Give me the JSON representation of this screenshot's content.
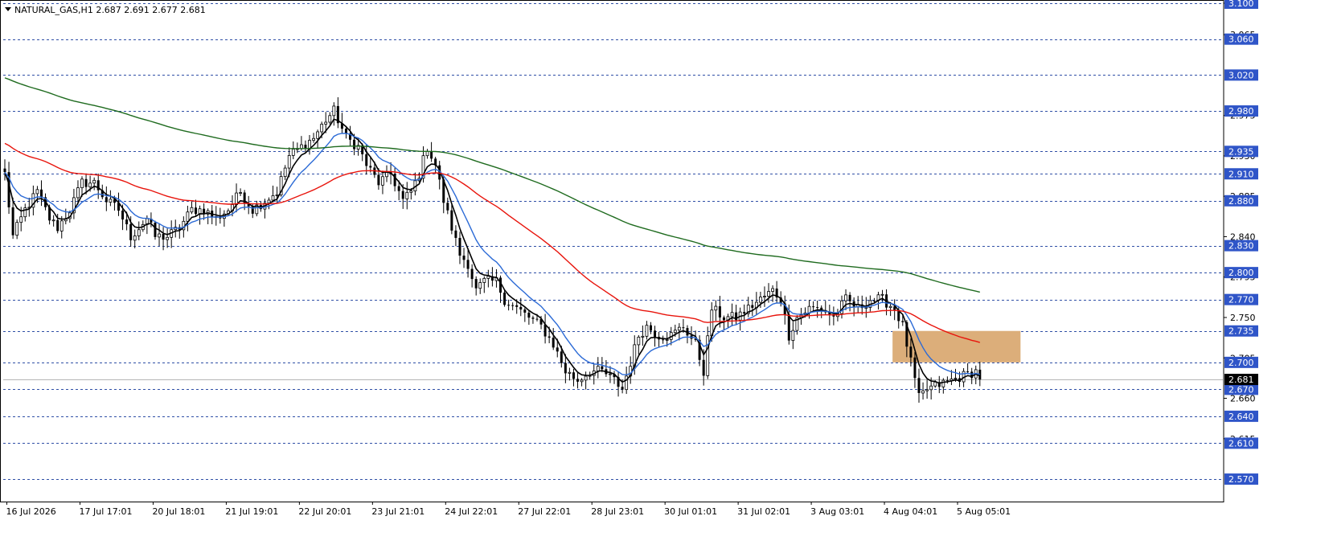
{
  "header": {
    "symbol_line": "NATURAL_GAS,H1  2.687 2.691 2.677 2.681",
    "menu_icon": "triangle-down-icon"
  },
  "colors": {
    "background": "#ffffff",
    "grid_dashed": "#2f4fa6",
    "price_label_bg": "#2f55c8",
    "current_price_bg": "#000000",
    "ma_fast": "#000000",
    "ma_mid": "#2b6ad6",
    "ma_slow": "#e8140c",
    "ma_long": "#1f6b1f",
    "zone": "#dcae7a",
    "candle": "#000000"
  },
  "chart_data": {
    "type": "candlestick",
    "symbol": "NATURAL_GAS",
    "timeframe": "H1",
    "ohlc_last": {
      "open": 2.687,
      "high": 2.691,
      "low": 2.677,
      "close": 2.681
    },
    "ylim": [
      2.545,
      3.1
    ],
    "x_tick_labels": [
      "16 Jul 2026",
      "17 Jul 17:01",
      "20 Jul 18:01",
      "21 Jul 19:01",
      "22 Jul 20:01",
      "23 Jul 21:01",
      "24 Jul 22:01",
      "27 Jul 22:01",
      "28 Jul 23:01",
      "30 Jul 01:01",
      "31 Jul 02:01",
      "3 Aug 03:01",
      "4 Aug 04:01",
      "5 Aug 05:01"
    ],
    "x_tick_positions": [
      0.5,
      18.5,
      36.5,
      54.5,
      72.5,
      90.5,
      108.5,
      126.5,
      144.5,
      162.5,
      180.5,
      198.5,
      216.5,
      234.5
    ],
    "x_range": [
      0,
      300
    ],
    "price_scale_ticks": [
      3.1,
      3.065,
      2.975,
      2.93,
      2.885,
      2.84,
      2.795,
      2.75,
      2.705,
      2.66,
      2.615
    ],
    "price_level_labels": [
      3.06,
      3.02,
      2.98,
      2.935,
      2.91,
      2.88,
      2.83,
      2.8,
      2.77,
      2.735,
      2.7,
      2.67,
      2.64,
      2.61,
      2.57
    ],
    "horizontal_levels": [
      3.1,
      3.06,
      3.02,
      2.98,
      2.935,
      2.91,
      2.88,
      2.83,
      2.8,
      2.77,
      2.735,
      2.7,
      2.67,
      2.64,
      2.61,
      2.57
    ],
    "current_price": 2.681,
    "price_label_format": 3,
    "zone": {
      "x_start": 218.5,
      "x_end": 250.0,
      "y_low": 2.7,
      "y_high": 2.735
    },
    "close_anchors": [
      [
        0,
        2.91
      ],
      [
        2,
        2.84
      ],
      [
        5,
        2.87
      ],
      [
        8,
        2.89
      ],
      [
        11,
        2.86
      ],
      [
        13,
        2.85
      ],
      [
        16,
        2.87
      ],
      [
        19,
        2.9
      ],
      [
        22,
        2.9
      ],
      [
        25,
        2.88
      ],
      [
        28,
        2.87
      ],
      [
        31,
        2.84
      ],
      [
        33,
        2.85
      ],
      [
        35,
        2.86
      ],
      [
        37,
        2.84
      ],
      [
        40,
        2.84
      ],
      [
        43,
        2.85
      ],
      [
        46,
        2.87
      ],
      [
        49,
        2.87
      ],
      [
        52,
        2.86
      ],
      [
        55,
        2.87
      ],
      [
        58,
        2.89
      ],
      [
        61,
        2.87
      ],
      [
        64,
        2.88
      ],
      [
        67,
        2.89
      ],
      [
        70,
        2.93
      ],
      [
        73,
        2.94
      ],
      [
        76,
        2.95
      ],
      [
        79,
        2.97
      ],
      [
        81,
        2.98
      ],
      [
        84,
        2.95
      ],
      [
        87,
        2.94
      ],
      [
        89,
        2.92
      ],
      [
        92,
        2.9
      ],
      [
        95,
        2.91
      ],
      [
        98,
        2.88
      ],
      [
        100,
        2.89
      ],
      [
        102,
        2.91
      ],
      [
        104,
        2.94
      ],
      [
        106,
        2.92
      ],
      [
        108,
        2.88
      ],
      [
        110,
        2.85
      ],
      [
        112,
        2.82
      ],
      [
        114,
        2.81
      ],
      [
        116,
        2.78
      ],
      [
        118,
        2.79
      ],
      [
        121,
        2.79
      ],
      [
        123,
        2.77
      ],
      [
        126,
        2.76
      ],
      [
        129,
        2.75
      ],
      [
        132,
        2.74
      ],
      [
        135,
        2.72
      ],
      [
        138,
        2.69
      ],
      [
        141,
        2.68
      ],
      [
        144,
        2.69
      ],
      [
        147,
        2.69
      ],
      [
        150,
        2.68
      ],
      [
        152,
        2.67
      ],
      [
        154,
        2.7
      ],
      [
        156,
        2.73
      ],
      [
        158,
        2.74
      ],
      [
        161,
        2.73
      ],
      [
        164,
        2.73
      ],
      [
        167,
        2.74
      ],
      [
        170,
        2.72
      ],
      [
        172,
        2.69
      ],
      [
        174,
        2.76
      ],
      [
        177,
        2.75
      ],
      [
        180,
        2.75
      ],
      [
        183,
        2.76
      ],
      [
        186,
        2.77
      ],
      [
        189,
        2.78
      ],
      [
        191,
        2.77
      ],
      [
        193,
        2.73
      ],
      [
        195,
        2.75
      ],
      [
        198,
        2.76
      ],
      [
        201,
        2.76
      ],
      [
        204,
        2.75
      ],
      [
        207,
        2.77
      ],
      [
        210,
        2.76
      ],
      [
        213,
        2.77
      ],
      [
        216,
        2.77
      ],
      [
        219,
        2.76
      ],
      [
        221,
        2.74
      ],
      [
        223,
        2.7
      ],
      [
        225,
        2.66
      ],
      [
        227,
        2.67
      ],
      [
        230,
        2.675
      ],
      [
        233,
        2.68
      ],
      [
        236,
        2.685
      ],
      [
        239,
        2.69
      ],
      [
        240,
        2.681
      ]
    ],
    "series": [
      {
        "name": "",
        "kind": "ma",
        "color": "#000000",
        "period": 5
      },
      {
        "name": "",
        "kind": "ma",
        "color": "#2b6ad6",
        "period": 12
      },
      {
        "name": "",
        "kind": "ma",
        "color": "#e8140c",
        "period": 60,
        "start_value": 2.945
      },
      {
        "name": "",
        "kind": "ma",
        "color": "#1f6b1f",
        "period": 180,
        "start_value": 3.018
      }
    ]
  }
}
